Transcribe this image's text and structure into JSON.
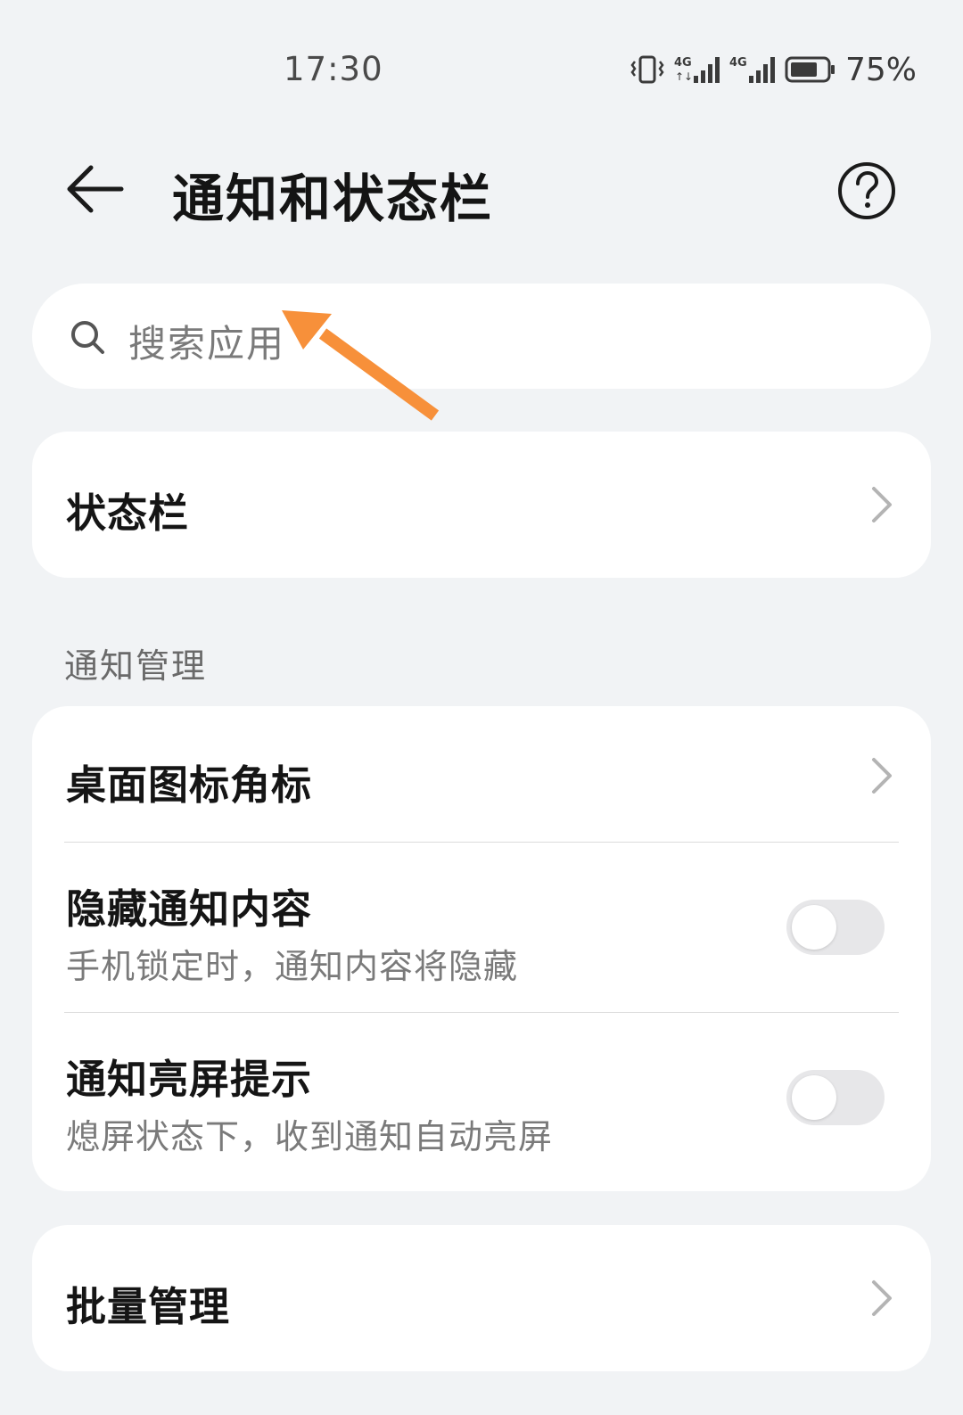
{
  "status_bar": {
    "time": "17:30",
    "battery_percent": "75%",
    "signal_icons": [
      "vibrate-icon",
      "4g-signal-icon",
      "4g-signal-icon",
      "battery-icon"
    ],
    "battery_level": 0.75
  },
  "header": {
    "title": "通知和状态栏",
    "back_icon": "arrow-left-icon",
    "help_icon": "question-circle-icon"
  },
  "search": {
    "placeholder": "搜索应用",
    "icon": "search-icon"
  },
  "annotation": {
    "arrow_color": "#f7903a"
  },
  "status_bar_card": {
    "label": "状态栏"
  },
  "notification_section": {
    "header": "通知管理",
    "items": [
      {
        "label": "桌面图标角标",
        "type": "link"
      },
      {
        "label": "隐藏通知内容",
        "subtitle": "手机锁定时，通知内容将隐藏",
        "type": "toggle",
        "enabled": false
      },
      {
        "label": "通知亮屏提示",
        "subtitle": "熄屏状态下，收到通知自动亮屏",
        "type": "toggle",
        "enabled": false
      }
    ]
  },
  "batch_card": {
    "label": "批量管理"
  },
  "colors": {
    "background": "#f1f3f5",
    "card": "#ffffff",
    "toggle_off": "#e7e7e9"
  }
}
